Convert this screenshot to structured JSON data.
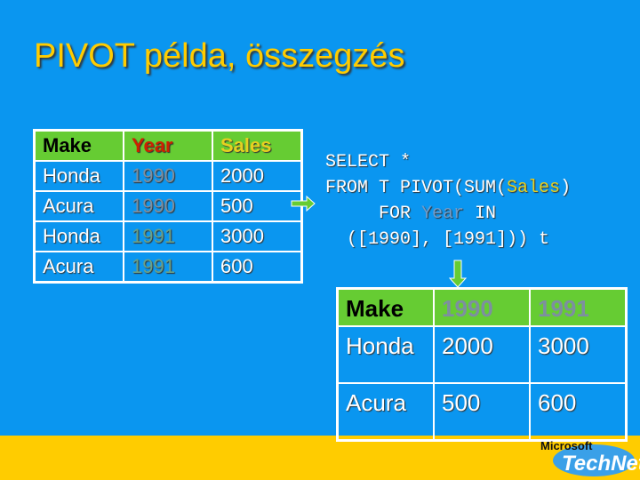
{
  "title": "PIVOT példa, összegzés",
  "source_table": {
    "headers": [
      "Make",
      "Year",
      "Sales"
    ],
    "rows": [
      [
        "Honda",
        "1990",
        "2000"
      ],
      [
        "Acura",
        "1990",
        "500"
      ],
      [
        "Honda",
        "1991",
        "3000"
      ],
      [
        "Acura",
        "1991",
        "600"
      ]
    ]
  },
  "sql": {
    "line1": "SELECT *",
    "line2a": "FROM T PIVOT(SUM(",
    "line2b": "Sales",
    "line2c": ")",
    "line3a": "     FOR ",
    "line3b": "Year",
    "line3c": " IN",
    "line4": "  ([1990], [1991])) t"
  },
  "result_table": {
    "headers": [
      "Make",
      "1990",
      "1991"
    ],
    "rows": [
      [
        "Honda",
        "2000",
        "3000"
      ],
      [
        "Acura",
        "500",
        "600"
      ]
    ]
  },
  "logo": {
    "top": "Microsoft",
    "bottom": "TechNet"
  },
  "colors": {
    "background": "#0a96f0",
    "title": "#ffcc00",
    "header_row": "#66cc33",
    "band": "#ffcc00",
    "arrow": "#66cc33"
  }
}
